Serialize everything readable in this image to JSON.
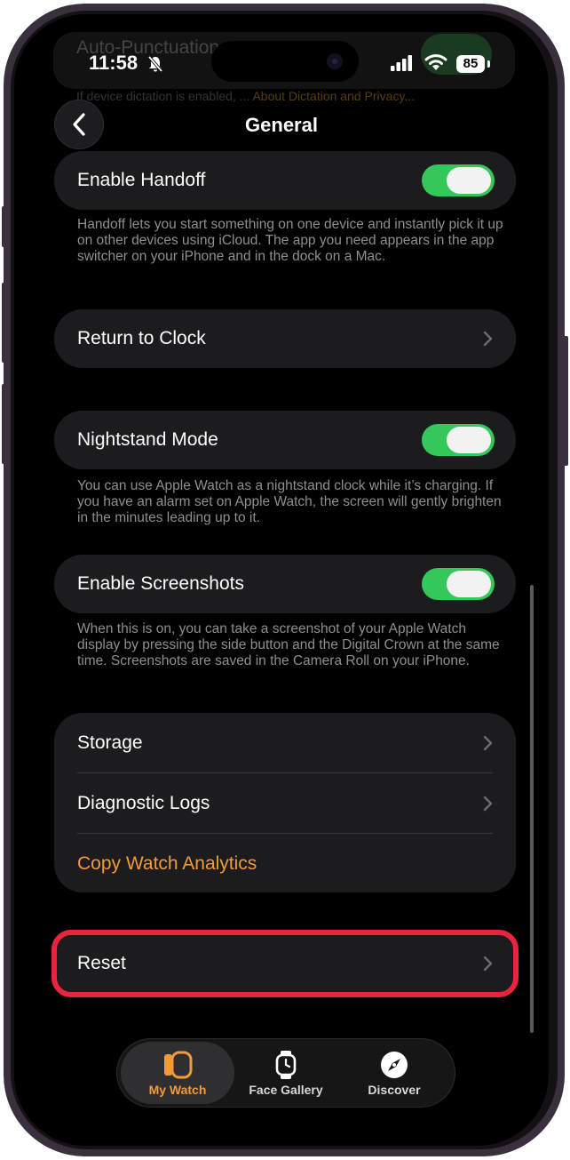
{
  "status_bar": {
    "time": "11:58",
    "battery": "85"
  },
  "background_row": {
    "label": "Auto-Punctuation",
    "footer": "If device dictation is enabled, ...",
    "footer_link": "About Dictation and Privacy..."
  },
  "header": {
    "title": "General"
  },
  "rows": {
    "handoff": {
      "label": "Enable Handoff",
      "on": true,
      "footer": "Handoff lets you start something on one device and instantly pick it up on other devices using iCloud. The app you need appears in the app switcher on your iPhone and in the dock on a Mac."
    },
    "return_to_clock": {
      "label": "Return to Clock"
    },
    "nightstand": {
      "label": "Nightstand Mode",
      "on": true,
      "footer": "You can use Apple Watch as a nightstand clock while it’s charging. If you have an alarm set on Apple Watch, the screen will gently brighten in the minutes leading up to it."
    },
    "screenshots": {
      "label": "Enable Screenshots",
      "on": true,
      "footer": "When this is on, you can take a screenshot of your Apple Watch display by pressing the side button and the Digital Crown at the same time. Screenshots are saved in the Camera Roll on your iPhone."
    },
    "storage": {
      "label": "Storage"
    },
    "diagnostic_logs": {
      "label": "Diagnostic Logs"
    },
    "copy_analytics": {
      "label": "Copy Watch Analytics"
    },
    "reset": {
      "label": "Reset"
    }
  },
  "tab_bar": {
    "tabs": [
      {
        "label": "My Watch",
        "icon": "watch-icon",
        "active": true
      },
      {
        "label": "Face Gallery",
        "icon": "watch-face-icon",
        "active": false
      },
      {
        "label": "Discover",
        "icon": "compass-icon",
        "active": false
      }
    ]
  },
  "colors": {
    "background": "#000000",
    "card": "#1c1c1e",
    "toggle_on": "#34c759",
    "accent": "#f29a38",
    "highlight": "#e8253c",
    "secondary_text": "#8e8e93"
  }
}
